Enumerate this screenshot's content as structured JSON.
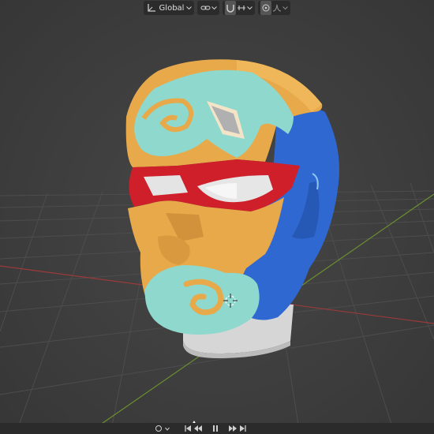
{
  "header": {
    "orientation_label": "Global",
    "icons": [
      "orientation-icon",
      "link-icon",
      "snap-magnet-icon",
      "snap-target-icon",
      "proportional-edit-icon",
      "falloff-curve-icon"
    ]
  },
  "viewport": {
    "object": "mask-head",
    "colors": {
      "mask_orange": "#e7a94a",
      "mask_blue": "#2f68d0",
      "mask_cyan": "#8fd8cd",
      "mask_red": "#cf1f2a",
      "head_grey": "#dcdcdc",
      "grid_x_axis": "#9c3a3a",
      "grid_y_axis": "#6c8f2e"
    }
  },
  "timeline": {
    "controls": [
      "keyframe-type-icon",
      "jump-start-icon",
      "play-reverse-icon",
      "pause-icon",
      "play-icon",
      "jump-end-icon"
    ]
  }
}
